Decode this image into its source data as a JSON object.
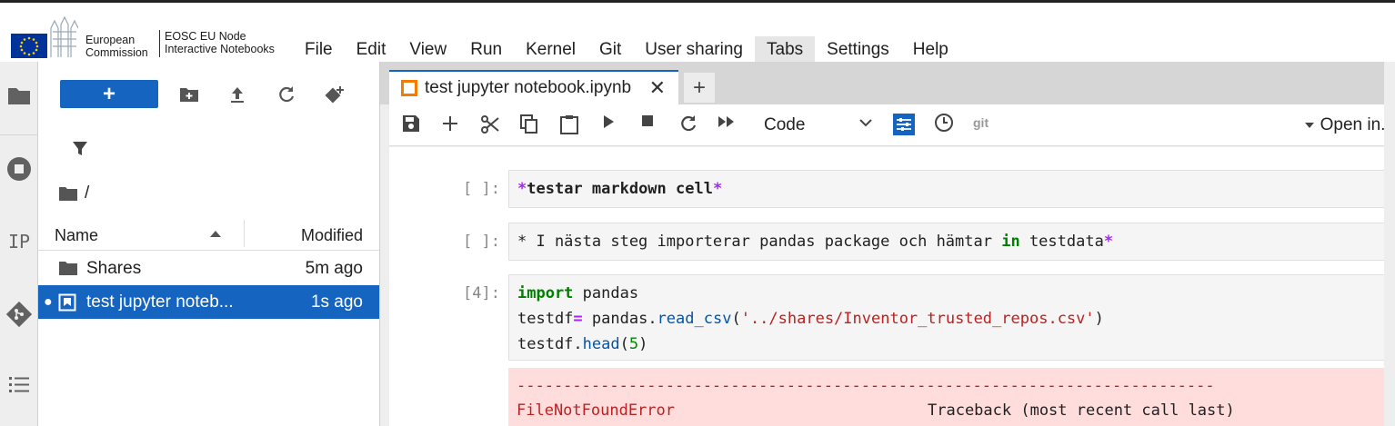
{
  "branding": {
    "org_line1": "European",
    "org_line2": "Commission",
    "node_line1": "EOSC EU Node",
    "node_line2": "Interactive Notebooks"
  },
  "menu": [
    "File",
    "Edit",
    "View",
    "Run",
    "Kernel",
    "Git",
    "User sharing",
    "Tabs",
    "Settings",
    "Help"
  ],
  "menu_active": "Tabs",
  "filebrowser": {
    "path": "/",
    "header_name": "Name",
    "header_modified": "Modified",
    "rows": [
      {
        "name": "Shares",
        "modified": "5m ago",
        "type": "folder",
        "selected": false
      },
      {
        "name": "test jupyter noteb...",
        "modified": "1s ago",
        "type": "notebook",
        "selected": true
      }
    ]
  },
  "tab": {
    "title": "test jupyter notebook.ipynb",
    "close": "✕",
    "add": "+"
  },
  "toolbar": {
    "cell_type": "Code",
    "git_label": "git",
    "open_in": "Open in..."
  },
  "cells": [
    {
      "prompt": "[ ]:"
    },
    {
      "prompt": "[ ]:"
    },
    {
      "prompt": "[4]:"
    }
  ],
  "code": {
    "md1_star_open": "*",
    "md1_text": "testar markdown cell",
    "md1_star_close": "*",
    "md2_pre": "* I nästa steg importerar pandas package och hämtar ",
    "md2_kw": "in",
    "md2_post": " testdata",
    "md2_star": "*",
    "l1_kw": "import",
    "l1_rest": " pandas",
    "l2_var": "testdf",
    "l2_eq": "=",
    "l2_mod": " pandas.",
    "l2_fn": "read_csv",
    "l2_paren": "(",
    "l2_str": "'../shares/Inventor_trusted_repos.csv'",
    "l2_close": ")",
    "l3_a": "testdf.",
    "l3_fn": "head",
    "l3_open": "(",
    "l3_num": "5",
    "l3_close": ")"
  },
  "error": {
    "dashes": "---------------------------------------------------------------------------",
    "name": "FileNotFoundError",
    "traceback": "Traceback (most recent call last)"
  },
  "colors": {
    "accent": "#1565c0",
    "error_bg": "#ffdddd"
  }
}
